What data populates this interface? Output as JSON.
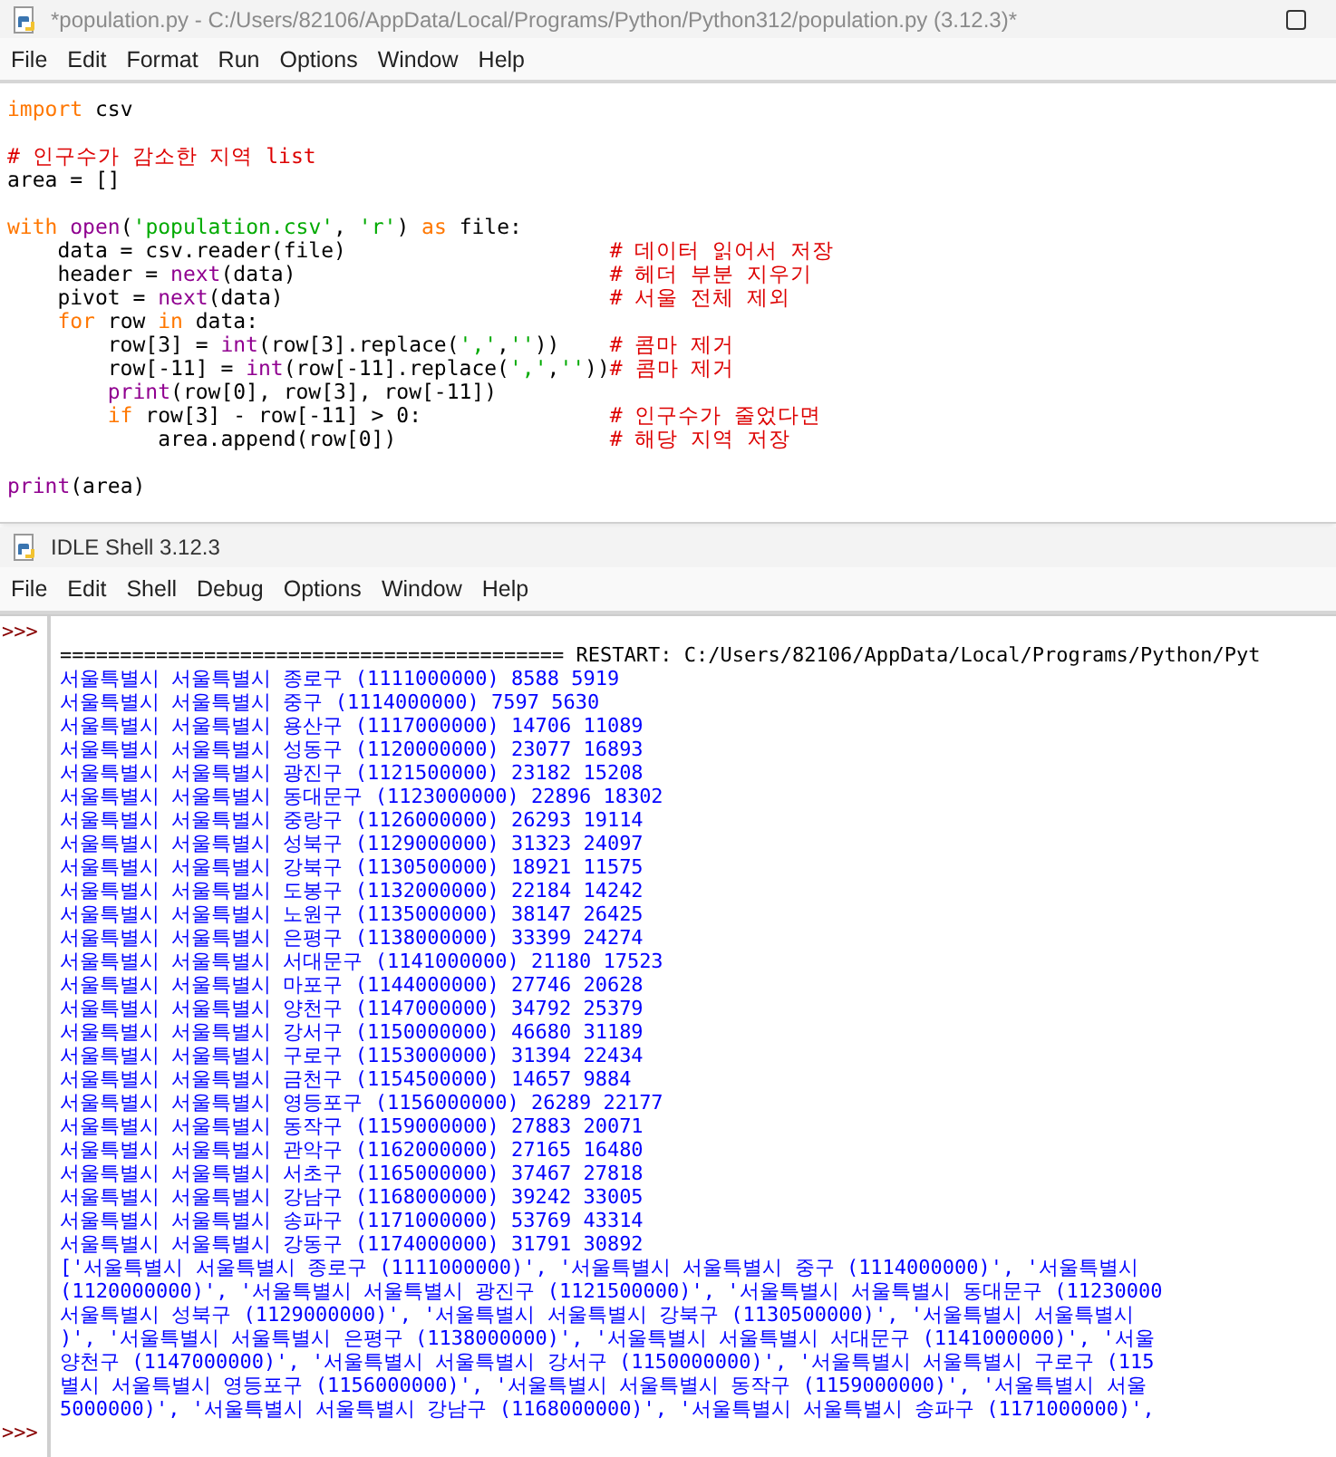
{
  "editor": {
    "title": "*population.py - C:/Users/82106/AppData/Local/Programs/Python/Python312/population.py (3.12.3)*",
    "menu": [
      "File",
      "Edit",
      "Format",
      "Run",
      "Options",
      "Window",
      "Help"
    ],
    "code_blocks": [
      [
        [
          {
            "kind": "keyword",
            "text": "import"
          },
          {
            "kind": "plain",
            "text": " csv"
          }
        ]
      ],
      [
        [
          {
            "kind": "comment",
            "text": "# 인구수가 감소한 지역 list"
          }
        ],
        [
          {
            "kind": "plain",
            "text": "area = []"
          }
        ]
      ],
      [
        [
          {
            "kind": "keyword",
            "text": "with "
          },
          {
            "kind": "builtin",
            "text": "open"
          },
          {
            "kind": "plain",
            "text": "("
          },
          {
            "kind": "string",
            "text": "'population.csv'"
          },
          {
            "kind": "plain",
            "text": ", "
          },
          {
            "kind": "string",
            "text": "'r'"
          },
          {
            "kind": "plain",
            "text": ") "
          },
          {
            "kind": "keyword",
            "text": "as"
          },
          {
            "kind": "plain",
            "text": " file:"
          }
        ],
        [
          {
            "kind": "plain",
            "text": "    data = csv.reader(file)                     "
          },
          {
            "kind": "comment",
            "text": "# 데이터 읽어서 저장"
          }
        ],
        [
          {
            "kind": "plain",
            "text": "    header = "
          },
          {
            "kind": "builtin",
            "text": "next"
          },
          {
            "kind": "plain",
            "text": "(data)                         "
          },
          {
            "kind": "comment",
            "text": "# 헤더 부분 지우기"
          }
        ],
        [
          {
            "kind": "plain",
            "text": "    pivot = "
          },
          {
            "kind": "builtin",
            "text": "next"
          },
          {
            "kind": "plain",
            "text": "(data)                          "
          },
          {
            "kind": "comment",
            "text": "# 서울 전체 제외"
          }
        ],
        [
          {
            "kind": "keyword",
            "text": "    for"
          },
          {
            "kind": "plain",
            "text": " row "
          },
          {
            "kind": "keyword",
            "text": "in"
          },
          {
            "kind": "plain",
            "text": " data:"
          }
        ],
        [
          {
            "kind": "plain",
            "text": "        row[3] = "
          },
          {
            "kind": "builtin",
            "text": "int"
          },
          {
            "kind": "plain",
            "text": "(row[3].replace("
          },
          {
            "kind": "string",
            "text": "','"
          },
          {
            "kind": "plain",
            "text": ","
          },
          {
            "kind": "string",
            "text": "''"
          },
          {
            "kind": "plain",
            "text": "))    "
          },
          {
            "kind": "comment",
            "text": "# 콤마 제거"
          }
        ],
        [
          {
            "kind": "plain",
            "text": "        row[-11] = "
          },
          {
            "kind": "builtin",
            "text": "int"
          },
          {
            "kind": "plain",
            "text": "(row[-11].replace("
          },
          {
            "kind": "string",
            "text": "','"
          },
          {
            "kind": "plain",
            "text": ","
          },
          {
            "kind": "string",
            "text": "''"
          },
          {
            "kind": "plain",
            "text": "))"
          },
          {
            "kind": "comment",
            "text": "# 콤마 제거"
          }
        ],
        [
          {
            "kind": "builtin",
            "text": "        print"
          },
          {
            "kind": "plain",
            "text": "(row[0], row[3], row[-11])"
          }
        ],
        [
          {
            "kind": "keyword",
            "text": "        if"
          },
          {
            "kind": "plain",
            "text": " row[3] - row[-11] > 0:               "
          },
          {
            "kind": "comment",
            "text": "# 인구수가 줄었다면"
          }
        ],
        [
          {
            "kind": "plain",
            "text": "            area.append(row[0])                 "
          },
          {
            "kind": "comment",
            "text": "# 해당 지역 저장"
          }
        ]
      ],
      [
        [
          {
            "kind": "builtin",
            "text": "print"
          },
          {
            "kind": "plain",
            "text": "(area)"
          }
        ]
      ]
    ]
  },
  "shell": {
    "title": "IDLE Shell 3.12.3",
    "menu": [
      "File",
      "Edit",
      "Shell",
      "Debug",
      "Options",
      "Window",
      "Help"
    ],
    "lines": [
      {
        "prompt": ">>>"
      },
      {
        "kind": "restart",
        "text": "========================================== RESTART: C:/Users/82106/AppData/Local/Programs/Python/Pyt"
      },
      {
        "kind": "stdout",
        "text": "서울특별시 서울특별시 종로구 (1111000000) 8588 5919"
      },
      {
        "kind": "stdout",
        "text": "서울특별시 서울특별시 중구 (1114000000) 7597 5630"
      },
      {
        "kind": "stdout",
        "text": "서울특별시 서울특별시 용산구 (1117000000) 14706 11089"
      },
      {
        "kind": "stdout",
        "text": "서울특별시 서울특별시 성동구 (1120000000) 23077 16893"
      },
      {
        "kind": "stdout",
        "text": "서울특별시 서울특별시 광진구 (1121500000) 23182 15208"
      },
      {
        "kind": "stdout",
        "text": "서울특별시 서울특별시 동대문구 (1123000000) 22896 18302"
      },
      {
        "kind": "stdout",
        "text": "서울특별시 서울특별시 중랑구 (1126000000) 26293 19114"
      },
      {
        "kind": "stdout",
        "text": "서울특별시 서울특별시 성북구 (1129000000) 31323 24097"
      },
      {
        "kind": "stdout",
        "text": "서울특별시 서울특별시 강북구 (1130500000) 18921 11575"
      },
      {
        "kind": "stdout",
        "text": "서울특별시 서울특별시 도봉구 (1132000000) 22184 14242"
      },
      {
        "kind": "stdout",
        "text": "서울특별시 서울특별시 노원구 (1135000000) 38147 26425"
      },
      {
        "kind": "stdout",
        "text": "서울특별시 서울특별시 은평구 (1138000000) 33399 24274"
      },
      {
        "kind": "stdout",
        "text": "서울특별시 서울특별시 서대문구 (1141000000) 21180 17523"
      },
      {
        "kind": "stdout",
        "text": "서울특별시 서울특별시 마포구 (1144000000) 27746 20628"
      },
      {
        "kind": "stdout",
        "text": "서울특별시 서울특별시 양천구 (1147000000) 34792 25379"
      },
      {
        "kind": "stdout",
        "text": "서울특별시 서울특별시 강서구 (1150000000) 46680 31189"
      },
      {
        "kind": "stdout",
        "text": "서울특별시 서울특별시 구로구 (1153000000) 31394 22434"
      },
      {
        "kind": "stdout",
        "text": "서울특별시 서울특별시 금천구 (1154500000) 14657 9884"
      },
      {
        "kind": "stdout",
        "text": "서울특별시 서울특별시 영등포구 (1156000000) 26289 22177"
      },
      {
        "kind": "stdout",
        "text": "서울특별시 서울특별시 동작구 (1159000000) 27883 20071"
      },
      {
        "kind": "stdout",
        "text": "서울특별시 서울특별시 관악구 (1162000000) 27165 16480"
      },
      {
        "kind": "stdout",
        "text": "서울특별시 서울특별시 서초구 (1165000000) 37467 27818"
      },
      {
        "kind": "stdout",
        "text": "서울특별시 서울특별시 강남구 (1168000000) 39242 33005"
      },
      {
        "kind": "stdout",
        "text": "서울특별시 서울특별시 송파구 (1171000000) 53769 43314"
      },
      {
        "kind": "stdout",
        "text": "서울특별시 서울특별시 강동구 (1174000000) 31791 30892"
      },
      {
        "kind": "stdout",
        "text": "['서울특별시 서울특별시 종로구 (1111000000)', '서울특별시 서울특별시 중구 (1114000000)', '서울특별시"
      },
      {
        "kind": "stdout",
        "text": "(1120000000)', '서울특별시 서울특별시 광진구 (1121500000)', '서울특별시 서울특별시 동대문구 (11230000"
      },
      {
        "kind": "stdout",
        "text": "서울특별시 성북구 (1129000000)', '서울특별시 서울특별시 강북구 (1130500000)', '서울특별시 서울특별시"
      },
      {
        "kind": "stdout",
        "text": ")', '서울특별시 서울특별시 은평구 (1138000000)', '서울특별시 서울특별시 서대문구 (1141000000)', '서울"
      },
      {
        "kind": "stdout",
        "text": "양천구 (1147000000)', '서울특별시 서울특별시 강서구 (1150000000)', '서울특별시 서울특별시 구로구 (115"
      },
      {
        "kind": "stdout",
        "text": "별시 서울특별시 영등포구 (1156000000)', '서울특별시 서울특별시 동작구 (1159000000)', '서울특별시 서울"
      },
      {
        "kind": "stdout",
        "text": "5000000)', '서울특별시 서울특별시 강남구 (1168000000)', '서울특별시 서울특별시 송파구 (1171000000)',"
      },
      {
        "prompt": ">>>"
      }
    ]
  }
}
